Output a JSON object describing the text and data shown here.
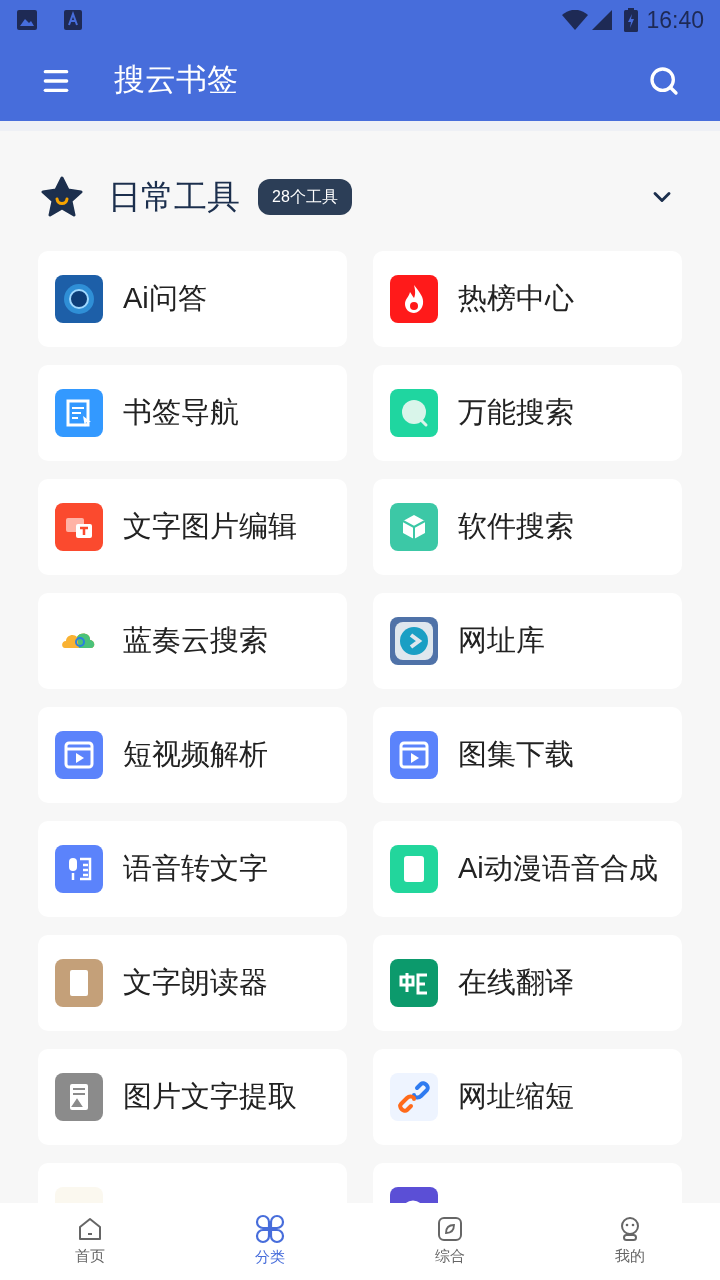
{
  "status_bar": {
    "time": "16:40"
  },
  "app_bar": {
    "title": "搜云书签"
  },
  "section": {
    "title": "日常工具",
    "badge": "28个工具",
    "expanded": true
  },
  "tools": [
    {
      "kind": "card",
      "label": "Ai问答"
    },
    {
      "kind": "card",
      "label": "热榜中心"
    },
    {
      "kind": "card",
      "label": "书签导航"
    },
    {
      "kind": "card",
      "label": "万能搜索"
    },
    {
      "kind": "card",
      "label": "文字图片编辑"
    },
    {
      "kind": "card",
      "label": "软件搜索"
    },
    {
      "kind": "card",
      "label": "蓝奏云搜索"
    },
    {
      "kind": "card",
      "label": "网址库"
    },
    {
      "kind": "card",
      "label": "短视频解析"
    },
    {
      "kind": "card",
      "label": "图集下载"
    },
    {
      "kind": "card",
      "label": "语音转文字"
    },
    {
      "kind": "card",
      "label": "Ai动漫语音合成"
    },
    {
      "kind": "card",
      "label": "文字朗读器"
    },
    {
      "kind": "card",
      "label": "在线翻译"
    },
    {
      "kind": "card",
      "label": "图片文字提取"
    },
    {
      "kind": "card",
      "label": "网址缩短"
    },
    {
      "kind": "cut_off"
    },
    {
      "kind": "cut_off"
    }
  ],
  "bottom_nav": [
    {
      "label": "首页",
      "selected": false
    },
    {
      "label": "分类",
      "selected": true
    },
    {
      "label": "综合",
      "selected": false
    },
    {
      "label": "我的",
      "selected": false
    }
  ]
}
